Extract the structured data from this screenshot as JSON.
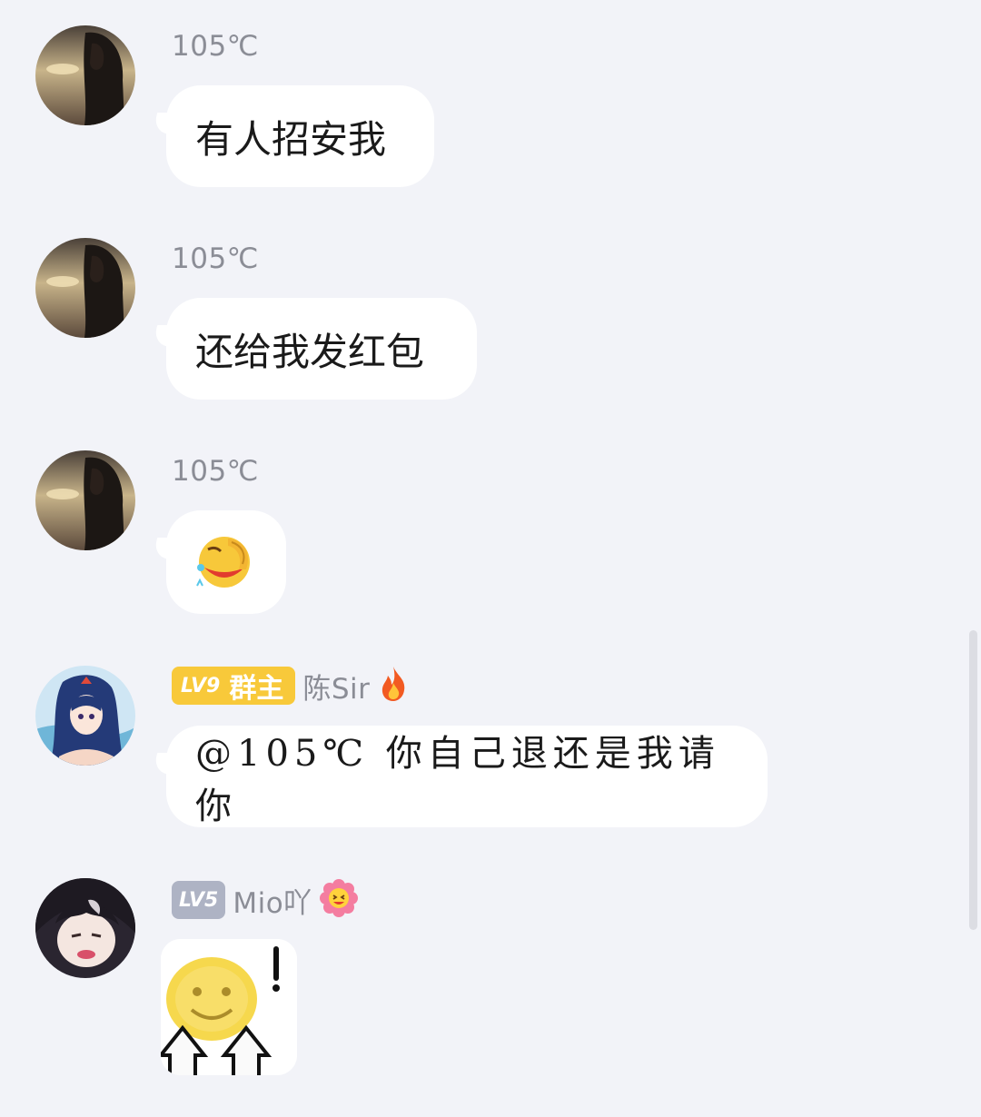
{
  "messages": [
    {
      "sender": "105℃",
      "text": "有人招安我"
    },
    {
      "sender": "105℃",
      "text": "还给我发红包"
    },
    {
      "sender": "105℃",
      "emoji": "facepalm-crying-laughing-emoji"
    },
    {
      "sender": "陈Sir",
      "badge_level": "LV9",
      "badge_role": "群主",
      "title_icon": "fire-icon",
      "text": "@105℃ 你自己退还是我请你"
    },
    {
      "sender": "Mio吖",
      "badge_level": "LV5",
      "title_icon": "flower-smile-icon",
      "sticker": "blurry-smiley-pointing-up-sticker"
    }
  ],
  "colors": {
    "background": "#f2f3f8",
    "bubble": "#ffffff",
    "name_text": "#8b8d96",
    "owner_badge": "#f8c93a",
    "member_badge": "#aeb3c4"
  }
}
